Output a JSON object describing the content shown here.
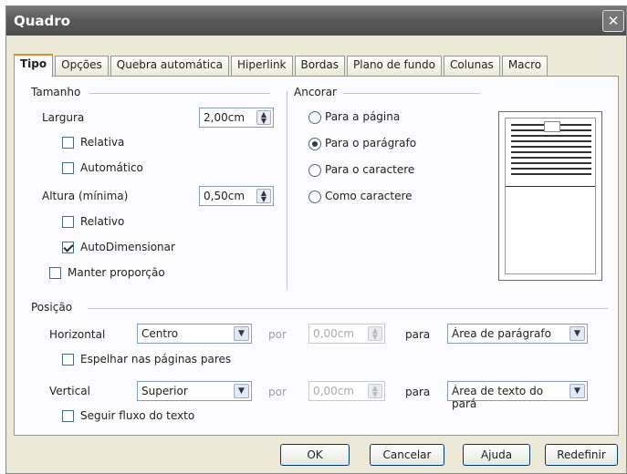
{
  "window": {
    "title": "Quadro"
  },
  "tabs": [
    {
      "label": "Tipo",
      "active": true
    },
    {
      "label": "Opções",
      "active": false
    },
    {
      "label": "Quebra automática",
      "active": false
    },
    {
      "label": "Hiperlink",
      "active": false
    },
    {
      "label": "Bordas",
      "active": false
    },
    {
      "label": "Plano de fundo",
      "active": false
    },
    {
      "label": "Colunas",
      "active": false
    },
    {
      "label": "Macro",
      "active": false
    }
  ],
  "size": {
    "group_label": "Tamanho",
    "width_label": "Largura",
    "width_value": "2,00cm",
    "relative_width_label": "Relativa",
    "relative_width_checked": false,
    "automatic_label": "Automático",
    "automatic_checked": false,
    "height_label": "Altura (mínima)",
    "height_value": "0,50cm",
    "relative_height_label": "Relativo",
    "relative_height_checked": false,
    "autosize_label": "AutoDimensionar",
    "autosize_checked": true,
    "keep_ratio_label": "Manter proporção",
    "keep_ratio_checked": false
  },
  "anchor": {
    "group_label": "Ancorar",
    "options": [
      {
        "label": "Para a página",
        "checked": false
      },
      {
        "label": "Para o parágrafo",
        "checked": true
      },
      {
        "label": "Para o caractere",
        "checked": false
      },
      {
        "label": "Como caractere",
        "checked": false
      }
    ]
  },
  "position": {
    "group_label": "Posição",
    "horizontal_label": "Horizontal",
    "horizontal_value": "Centro",
    "by_label": "por",
    "horizontal_by_value": "0,00cm",
    "to_label": "para",
    "horizontal_to_value": "Área de parágrafo",
    "mirror_label": "Espelhar nas páginas pares",
    "mirror_checked": false,
    "vertical_label": "Vertical",
    "vertical_value": "Superior",
    "vertical_by_value": "0,00cm",
    "vertical_to_value": "Área de texto do pará",
    "follow_flow_label": "Seguir fluxo do texto",
    "follow_flow_checked": false
  },
  "buttons": {
    "ok": "OK",
    "cancel": "Cancelar",
    "help": "Ajuda",
    "reset": "Redefinir"
  }
}
